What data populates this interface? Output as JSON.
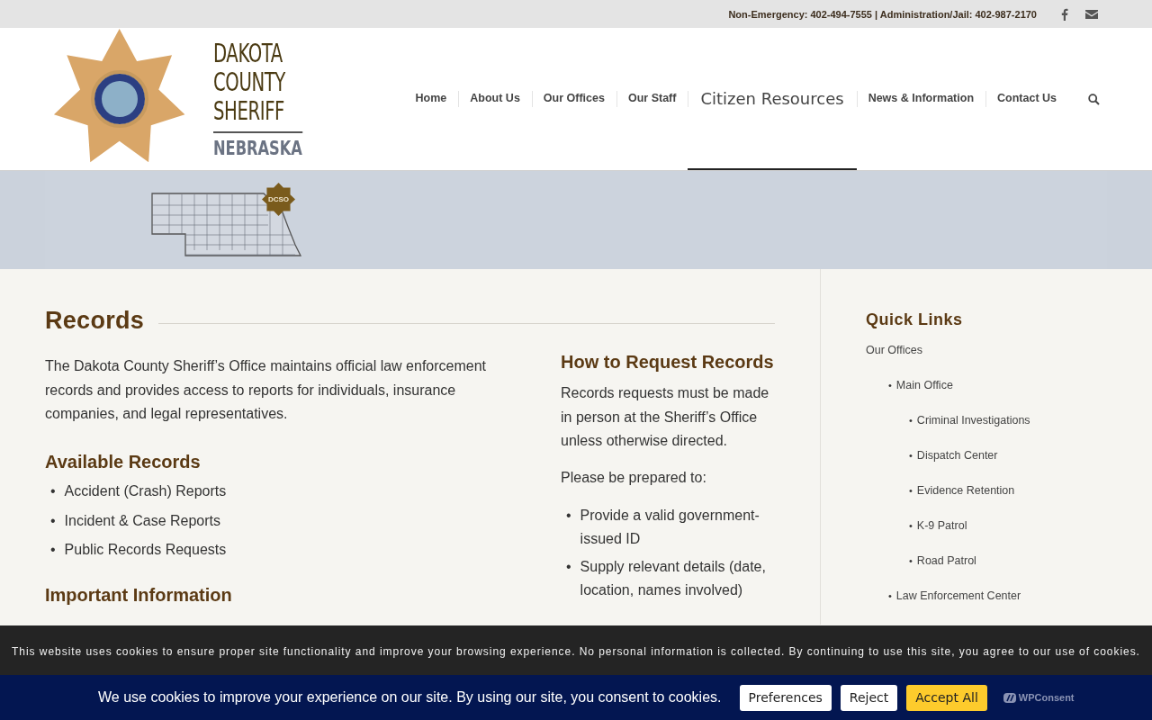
{
  "top_bar": {
    "contact": "Non-Emergency: 402-494-7555 | Administration/Jail: 402-987-2170",
    "social": [
      {
        "kind": "facebook"
      },
      {
        "kind": "mail"
      }
    ]
  },
  "logo": {
    "lines": [
      "DAKOTA",
      "COUNTY",
      "SHERIFF"
    ],
    "state": "NEBRASKA"
  },
  "nav": {
    "items": [
      {
        "label": "Home",
        "selected": false
      },
      {
        "label": "About Us",
        "selected": false
      },
      {
        "label": "Our Offices",
        "selected": false
      },
      {
        "label": "Our Staff",
        "selected": false
      },
      {
        "label": "Citizen Resources",
        "selected": true
      },
      {
        "label": "News & Information",
        "selected": false
      },
      {
        "label": "Contact Us",
        "selected": false
      }
    ]
  },
  "banner": {
    "badge": "DCSO"
  },
  "article": {
    "title": "Records",
    "intro": "The Dakota County Sheriff’s Office maintains official law enforcement records and provides access to reports for individuals, insurance companies, and legal representatives.",
    "sections": [
      {
        "heading": "Available Records",
        "marker": "•",
        "items": [
          "Accident (Crash) Reports",
          "Incident & Case Reports",
          "Public Records Requests"
        ]
      },
      {
        "heading": "Important Information"
      }
    ],
    "request": {
      "heading": "How to Request Records",
      "paragraphs": [
        "Records requests must be made in person at the Sheriff’s Office unless otherwise directed.",
        "Please be prepared to:"
      ],
      "marker": "•",
      "items": [
        "Provide a valid government-issued ID",
        "Supply relevant details (date, location, names involved)"
      ]
    }
  },
  "quick_links": {
    "title": "Quick Links",
    "marker": "•",
    "items": [
      {
        "label": "Our Offices",
        "children": [
          {
            "label": "Main Office",
            "children": [
              {
                "label": "Criminal Investigations"
              },
              {
                "label": "Dispatch Center"
              },
              {
                "label": "Evidence Retention"
              },
              {
                "label": "K-9 Patrol"
              },
              {
                "label": "Road Patrol"
              }
            ]
          },
          {
            "label": "Law Enforcement Center"
          }
        ]
      }
    ]
  },
  "cookie_notice": {
    "text": "This website uses cookies to ensure proper site functionality and improve your browsing experience. No personal information is collected. By continuing to use this site, you agree to our use of cookies."
  },
  "consent_bar": {
    "text": "We use cookies to improve your experience on our site. By using our site, you consent to cookies.",
    "buttons": [
      {
        "label": "Preferences",
        "kind": "plain"
      },
      {
        "label": "Reject",
        "kind": "plain"
      },
      {
        "label": "Accept All",
        "kind": "primary"
      }
    ],
    "brand": "WPConsent"
  }
}
